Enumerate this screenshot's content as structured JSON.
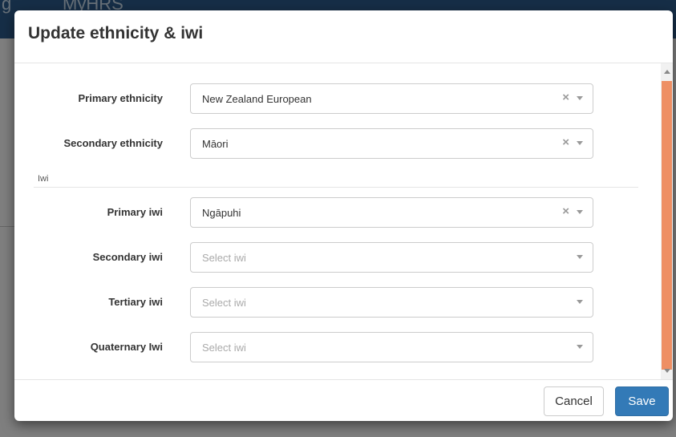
{
  "background": {
    "brand": "MyHRS",
    "brand_left": "g"
  },
  "modal": {
    "title": "Update ethnicity & iwi",
    "ethnicity_fields": [
      {
        "label": "Primary ethnicity",
        "value": "New Zealand European",
        "has_clear": true
      },
      {
        "label": "Secondary ethnicity",
        "value": "Māori",
        "has_clear": true
      }
    ],
    "iwi_section_label": "Iwi",
    "iwi_fields": [
      {
        "label": "Primary iwi",
        "value": "Ngāpuhi",
        "has_clear": true
      },
      {
        "label": "Secondary iwi",
        "placeholder": "Select iwi"
      },
      {
        "label": "Tertiary iwi",
        "placeholder": "Select iwi"
      },
      {
        "label": "Quaternary Iwi",
        "placeholder": "Select iwi"
      }
    ],
    "icons": {
      "clear": "×",
      "dropdown": "chevron-down"
    },
    "footer": {
      "cancel_label": "Cancel",
      "save_label": "Save"
    }
  },
  "colors": {
    "primary_button": "#337ab7",
    "scroll_thumb": "#ee8f64",
    "navbar": "#2c5d8f"
  }
}
